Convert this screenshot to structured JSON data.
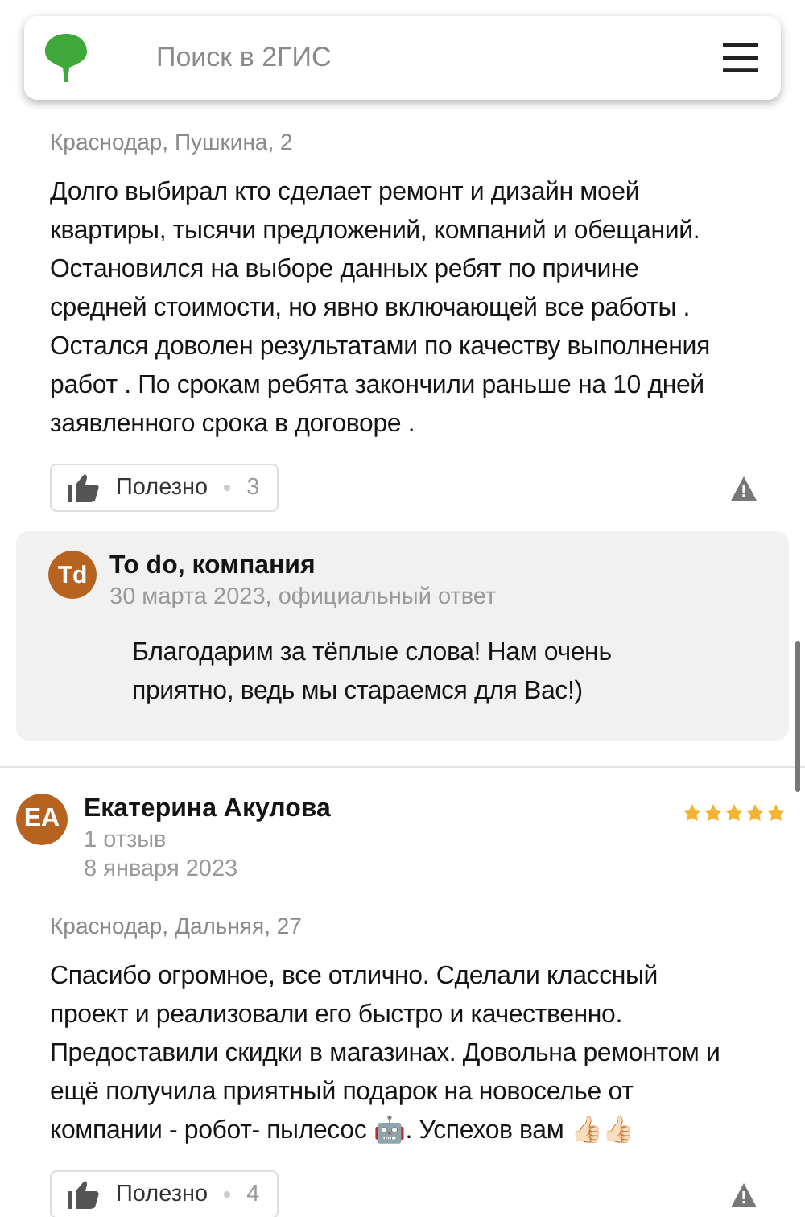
{
  "search": {
    "placeholder": "Поиск в 2ГИС"
  },
  "reviews": [
    {
      "address": "Краснодар, Пушкина, 2",
      "text": "Долго выбирал кто сделает ремонт и дизайн моей квартиры, тысячи предложений, компаний и обещаний. Остановился на выборе данных ребят по причине средней стоимости, но явно включающей все работы . Остался доволен результатами по качеству выполнения работ . По срокам ребята закончили раньше на 10 дней заявленного срока в договоре .",
      "useful": {
        "label": "Полезно",
        "count": "3"
      },
      "reply": {
        "initials": "Td",
        "author": "To do, компания",
        "meta": "30 марта 2023, официальный ответ",
        "text": "Благодарим за тёплые слова! Нам очень приятно, ведь мы стараемся для Вас!)"
      }
    },
    {
      "initials": "ЕА",
      "author": "Екатерина Акулова",
      "stars": 5,
      "count": "1 отзыв",
      "date": "8 января 2023",
      "address": "Краснодар, Дальняя, 27",
      "text": "Спасибо огромное, все отлично. Сделали классный проект и реализовали его быстро и качественно. Предоставили скидки в магазинах. Довольна ремонтом и ещё получила приятный подарок на новоселье от компании - робот- пылесос 🤖. Успехов вам 👍🏻👍🏻",
      "useful": {
        "label": "Полезно",
        "count": "4"
      }
    }
  ]
}
